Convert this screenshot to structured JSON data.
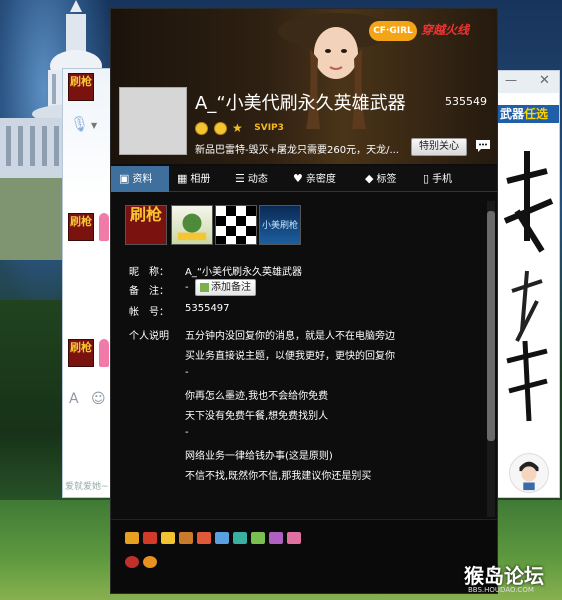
{
  "profile": {
    "name": "A_“小美代刷永久英雄武器",
    "qq_number": "535549",
    "svip": "SVIP3",
    "status": "新品巴雷特-毁灭+屠龙只需要260元，天龙/...",
    "care_button": "特别关心",
    "header_brand": "CF·GIRL",
    "header_brand2": "穿越火线"
  },
  "tabs": [
    {
      "label": "资料",
      "icon": "id-card-icon",
      "active": true
    },
    {
      "label": "相册",
      "icon": "photo-icon",
      "active": false
    },
    {
      "label": "动态",
      "icon": "list-icon",
      "active": false
    },
    {
      "label": "亲密度",
      "icon": "heart-icon",
      "active": false
    },
    {
      "label": "标签",
      "icon": "tag-icon",
      "active": false
    },
    {
      "label": "手机",
      "icon": "phone-icon",
      "active": false
    }
  ],
  "thumbs": [
    {
      "text": "刷枪",
      "alt": "brand-logo"
    },
    {
      "text": "",
      "alt": "cartoon"
    },
    {
      "text": "",
      "alt": "checker"
    },
    {
      "text": "小美刷枪",
      "alt": "blue-banner"
    }
  ],
  "info": {
    "nickname_label": "昵　称：",
    "nickname_value": "A_“小美代刷永久英雄武器",
    "remark_label": "备　注：",
    "remark_value": "-",
    "add_note_button": "添加备注",
    "account_label": "帐　号：",
    "account_value": "5355497",
    "desc_label": "个人说明",
    "desc_lines": [
      "五分钟内没回复你的消息，就是人不在电脑旁边",
      "买业务直接说主题，以便我更好，更快的回复你",
      "-",
      "你再怎么墨迹,我也不会给你免费",
      "天下没有免费午餐,想免费找别人",
      "-",
      "网络业务一律给钱办事(这是原则)",
      "不信不找,既然你不信,那我建议你还是别买"
    ]
  },
  "left_window": {
    "logo_text": "刷枪",
    "signature": "爱就爱她~"
  },
  "right_window": {
    "banner_prefix": "武器",
    "banner_highlight": "任选",
    "min_symbol": "—",
    "close_symbol": "✕"
  },
  "watermark": {
    "text": "猴岛论坛",
    "url": "BBS.HOUDAO.COM"
  },
  "colors": {
    "tab_active": "#3f6f9c",
    "card_bg": "#0d0d0d",
    "svip_gold": "#f5b81e"
  }
}
